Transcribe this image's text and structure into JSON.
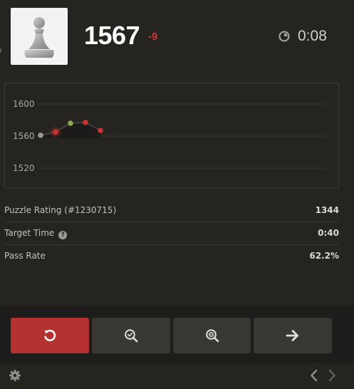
{
  "player": {
    "rating": "1567",
    "rating_change": "-9",
    "avatar_icon": "pawn-icon"
  },
  "timer": {
    "value": "0:08",
    "icon": "clock-icon"
  },
  "chart_data": {
    "type": "line",
    "y_ticks": [
      "1600",
      "1560",
      "1520"
    ],
    "ylim": [
      1500,
      1620
    ],
    "grid": true,
    "series": [
      {
        "points": [
          {
            "y": 1561,
            "result": "neutral"
          },
          {
            "y": 1565,
            "result": "fail"
          },
          {
            "y": 1576,
            "result": "pass"
          },
          {
            "y": 1577,
            "result": "fail"
          },
          {
            "y": 1567,
            "result": "fail"
          }
        ]
      }
    ],
    "colors": {
      "pass": "#8aa84f",
      "fail": "#cc3333",
      "neutral": "#9a9a9a",
      "line": "#4a4845"
    }
  },
  "stats": [
    {
      "label": "Puzzle Rating (#1230715)",
      "value": "1344"
    },
    {
      "label": "Target Time",
      "value": "0:40",
      "help_icon": "question-circle-icon"
    },
    {
      "label": "Pass Rate",
      "value": "62.2%"
    }
  ],
  "controls": {
    "buttons": [
      {
        "name": "retry",
        "icon": "retry-icon",
        "color": "#b43130"
      },
      {
        "name": "analysis",
        "icon": "magnify-check-icon",
        "color": "#393734"
      },
      {
        "name": "solution",
        "icon": "magnify-target-icon",
        "color": "#393734"
      },
      {
        "name": "next",
        "icon": "arrow-right-icon",
        "color": "#393734"
      }
    ]
  },
  "footer": {
    "settings_icon": "gear-icon",
    "prev_icon": "chevron-left-icon",
    "next_icon": "chevron-right-icon"
  }
}
